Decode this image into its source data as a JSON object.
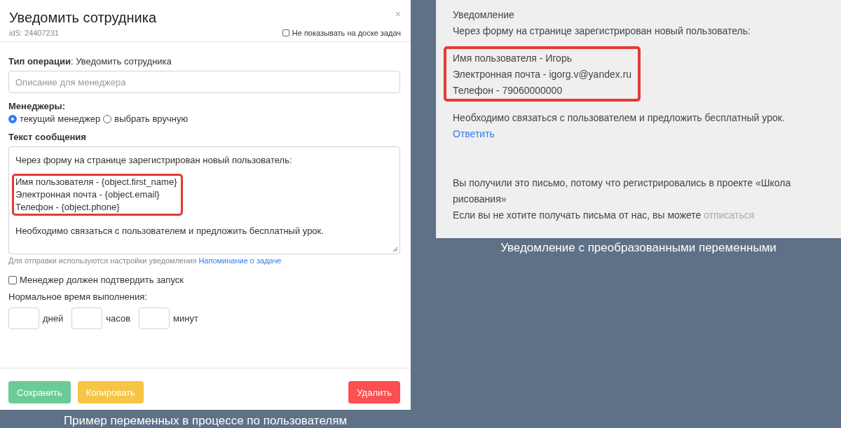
{
  "modal": {
    "title": "Уведомить сотрудника",
    "close": "×",
    "ids": "idS: 24407231",
    "hide_on_board": {
      "label": "Не показывать на доске задач",
      "checked": false
    },
    "operation_type": "**Тип операции**: Уведомить сотрудника",
    "description": {
      "placeholder": "Описание для менеджера"
    },
    "managers": {
      "label": "Менеджеры:",
      "options": [
        {
          "label": "текущий менеджер",
          "selected": true
        },
        {
          "label": "выбрать вручную",
          "selected": false
        }
      ]
    },
    "message": {
      "label": "Текст сообщения",
      "blocks": [
        {
          "highlighted": false,
          "lines": [
            "Через форму на странице зарегистрирован новый пользователь:"
          ]
        },
        {
          "highlighted": true,
          "lines": [
            "Имя пользователя - {object.first_name}",
            "Электронная почта - {object.email}",
            "Телефон - {object.phone}"
          ]
        },
        {
          "highlighted": false,
          "lines": [
            "Необходимо связаться с пользователем и предложить бесплатный урок."
          ]
        }
      ]
    },
    "hint": {
      "text": "Для отправки используются настройки уведомления",
      "link": "Напоминание о задаче"
    },
    "confirm": {
      "label": "Менеджер должен подтвердить запуск",
      "checked": false
    },
    "duration": {
      "label": "Нормальное время выполнения:",
      "units": [
        "дней",
        "часов",
        "минут"
      ]
    },
    "buttons": [
      {
        "label": "Сохранить",
        "kind": "save"
      },
      {
        "label": "Копировать",
        "kind": "copy"
      },
      {
        "label": "Удалить",
        "kind": "delete"
      }
    ]
  },
  "left_caption": "Пример переменных в процессе по пользователям",
  "notification": {
    "title": "Уведомление",
    "blocks": [
      {
        "highlighted": false,
        "lines": [
          "Через форму на странице зарегистрирован новый пользователь:"
        ]
      },
      {
        "highlighted": true,
        "lines": [
          "Имя пользователя - Игорь",
          "Электронная почта - igorg.v@yandex.ru",
          "Телефон - 79060000000"
        ]
      },
      {
        "highlighted": false,
        "lines": [
          "Необходимо связаться с пользователем и предложить бесплатный урок."
        ]
      }
    ],
    "reply_link": "Ответить",
    "footer": "Вы получили это письмо, потому что регистрировались в проекте «Школа рисования»",
    "unsubscribe": {
      "text": "Если вы не хотите получать письма от нас, вы можете",
      "link": "отписаться"
    }
  },
  "right_caption": "Уведомление с преобразованными переменными"
}
